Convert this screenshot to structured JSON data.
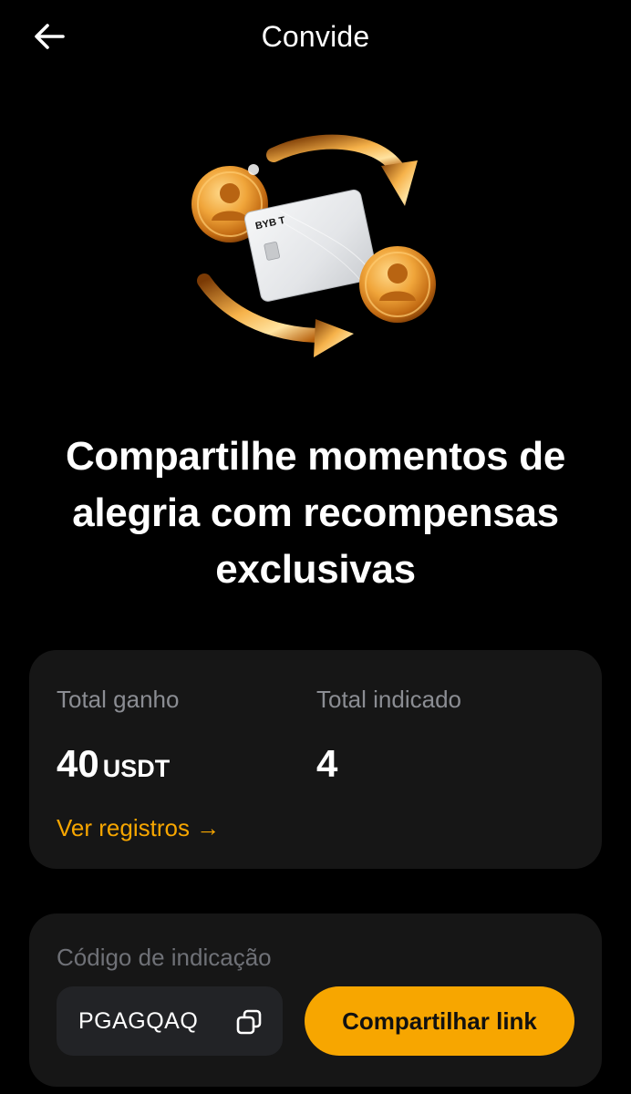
{
  "header": {
    "title": "Convide",
    "back_icon": "arrow-left-icon"
  },
  "hero": {
    "card_brand": "BYB T",
    "icons": [
      "person-coin-icon",
      "person-coin-icon",
      "curved-arrow-icon",
      "curved-arrow-icon",
      "bybit-card-illustration"
    ]
  },
  "headline": "Compartilhe momentos de alegria com recompensas exclusivas",
  "stats": {
    "earned_label": "Total ganho",
    "earned_value": "40",
    "earned_unit": "USDT",
    "referred_label": "Total indicado",
    "referred_value": "4",
    "records_link": "Ver registros →"
  },
  "referral": {
    "label": "Código de indicação",
    "code": "PGAGQAQ",
    "copy_icon": "copy-icon",
    "share_button": "Compartilhar link"
  },
  "colors": {
    "background": "#000000",
    "card": "#161616",
    "accent": "#f7a600",
    "muted_text": "#8b8d93"
  }
}
